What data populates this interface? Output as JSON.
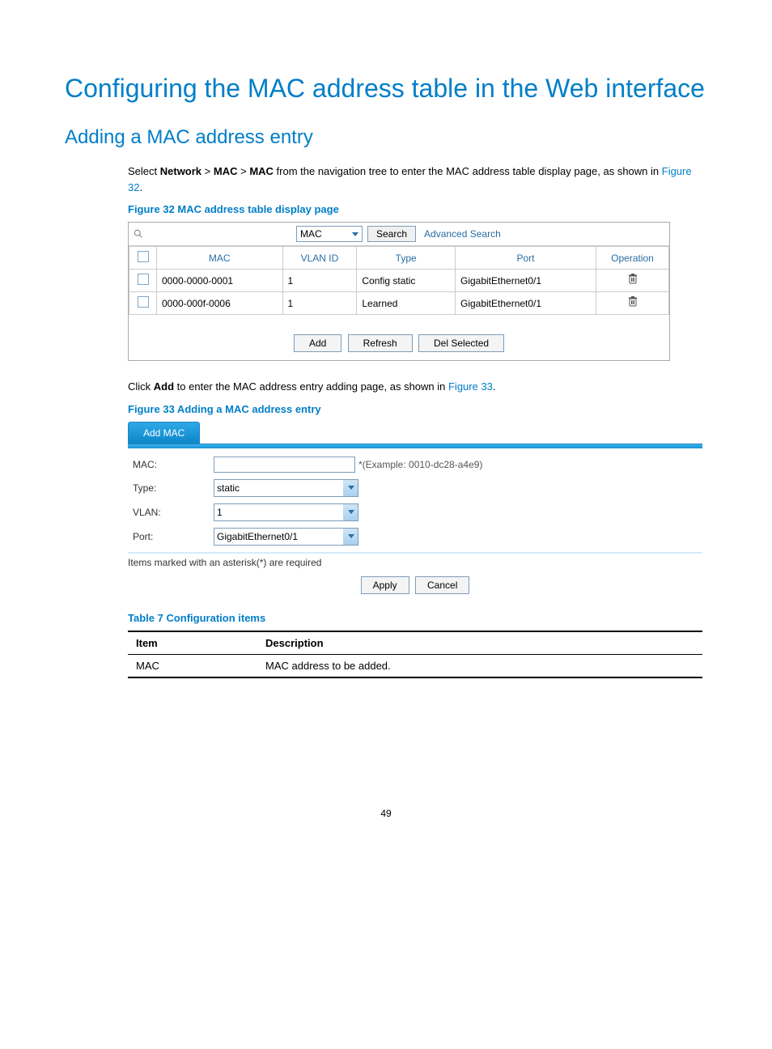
{
  "h1": "Configuring the MAC address table in the Web interface",
  "h2": "Adding a MAC address entry",
  "intro": {
    "pre": "Select ",
    "nav1": "Network",
    "gt": " > ",
    "nav2": "MAC",
    "nav3": "MAC",
    "post": " from the navigation tree to enter the MAC address table display page, as shown in ",
    "figref": "Figure 32",
    "end": "."
  },
  "fig32_caption": "Figure 32 MAC address table display page",
  "fig32": {
    "search_field_select": "MAC",
    "search_btn": "Search",
    "adv_search": "Advanced Search",
    "headers": {
      "mac": "MAC",
      "vlan": "VLAN ID",
      "type": "Type",
      "port": "Port",
      "op": "Operation"
    },
    "rows": [
      {
        "mac": "0000-0000-0001",
        "vlan": "1",
        "type": "Config static",
        "port": "GigabitEthernet0/1"
      },
      {
        "mac": "0000-000f-0006",
        "vlan": "1",
        "type": "Learned",
        "port": "GigabitEthernet0/1"
      }
    ],
    "btns": {
      "add": "Add",
      "refresh": "Refresh",
      "del": "Del Selected"
    }
  },
  "p2": {
    "pre": "Click ",
    "add": "Add",
    "mid": " to enter the MAC address entry adding page, as shown in ",
    "figref": "Figure 33",
    "end": "."
  },
  "fig33_caption": "Figure 33 Adding a MAC address entry",
  "fig33": {
    "tab": "Add MAC",
    "mac_lbl": "MAC:",
    "mac_hint": "*(Example: 0010-dc28-a4e9)",
    "type_lbl": "Type:",
    "type_val": "static",
    "vlan_lbl": "VLAN:",
    "vlan_val": "1",
    "port_lbl": "Port:",
    "port_val": "GigabitEthernet0/1",
    "note": "Items marked with an asterisk(*) are required",
    "apply": "Apply",
    "cancel": "Cancel"
  },
  "table7_caption": "Table 7 Configuration items",
  "table7": {
    "h1": "Item",
    "h2": "Description",
    "r1c1": "MAC",
    "r1c2": "MAC address to be added."
  },
  "page_num": "49"
}
